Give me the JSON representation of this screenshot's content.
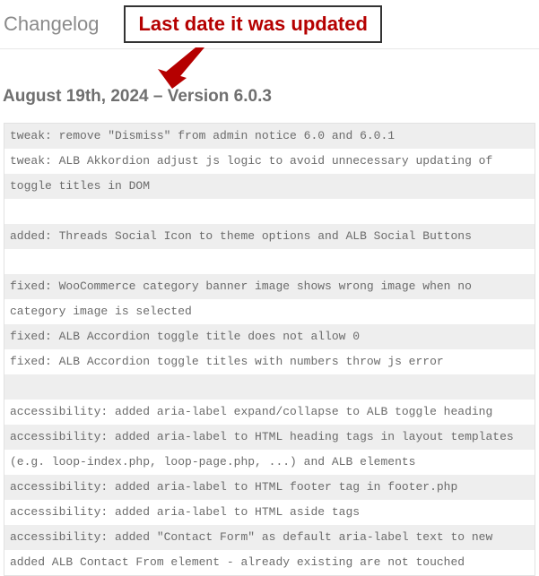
{
  "header": {
    "title": "Changelog",
    "callout": "Last date it was updated",
    "arrow_color": "#b50000"
  },
  "version": {
    "heading": "August 19th, 2024 – Version 6.0.3"
  },
  "log_lines": [
    "tweak: remove \"Dismiss\" from admin notice 6.0 and 6.0.1",
    "tweak: ALB Akkordion adjust js logic to avoid unnecessary updating of toggle titles in DOM",
    "",
    "added: Threads Social Icon to theme options and ALB Social Buttons",
    "",
    "fixed: WooCommerce category banner image shows wrong image when no category image is selected",
    "fixed: ALB Accordion toggle title does not allow 0",
    "fixed: ALB Accordion toggle titles with numbers throw js error",
    "",
    "accessibility: added aria-label expand/collapse to ALB toggle heading",
    "accessibility: added aria-label to HTML heading tags in layout templates (e.g. loop-index.php, loop-page.php, ...) and ALB elements",
    "accessibility: added aria-label to HTML footer tag in footer.php",
    "accessibility: added aria-label to HTML aside tags",
    "accessibility: added \"Contact Form\" as default aria-label text to new added ALB Contact From element - already existing are not touched"
  ]
}
